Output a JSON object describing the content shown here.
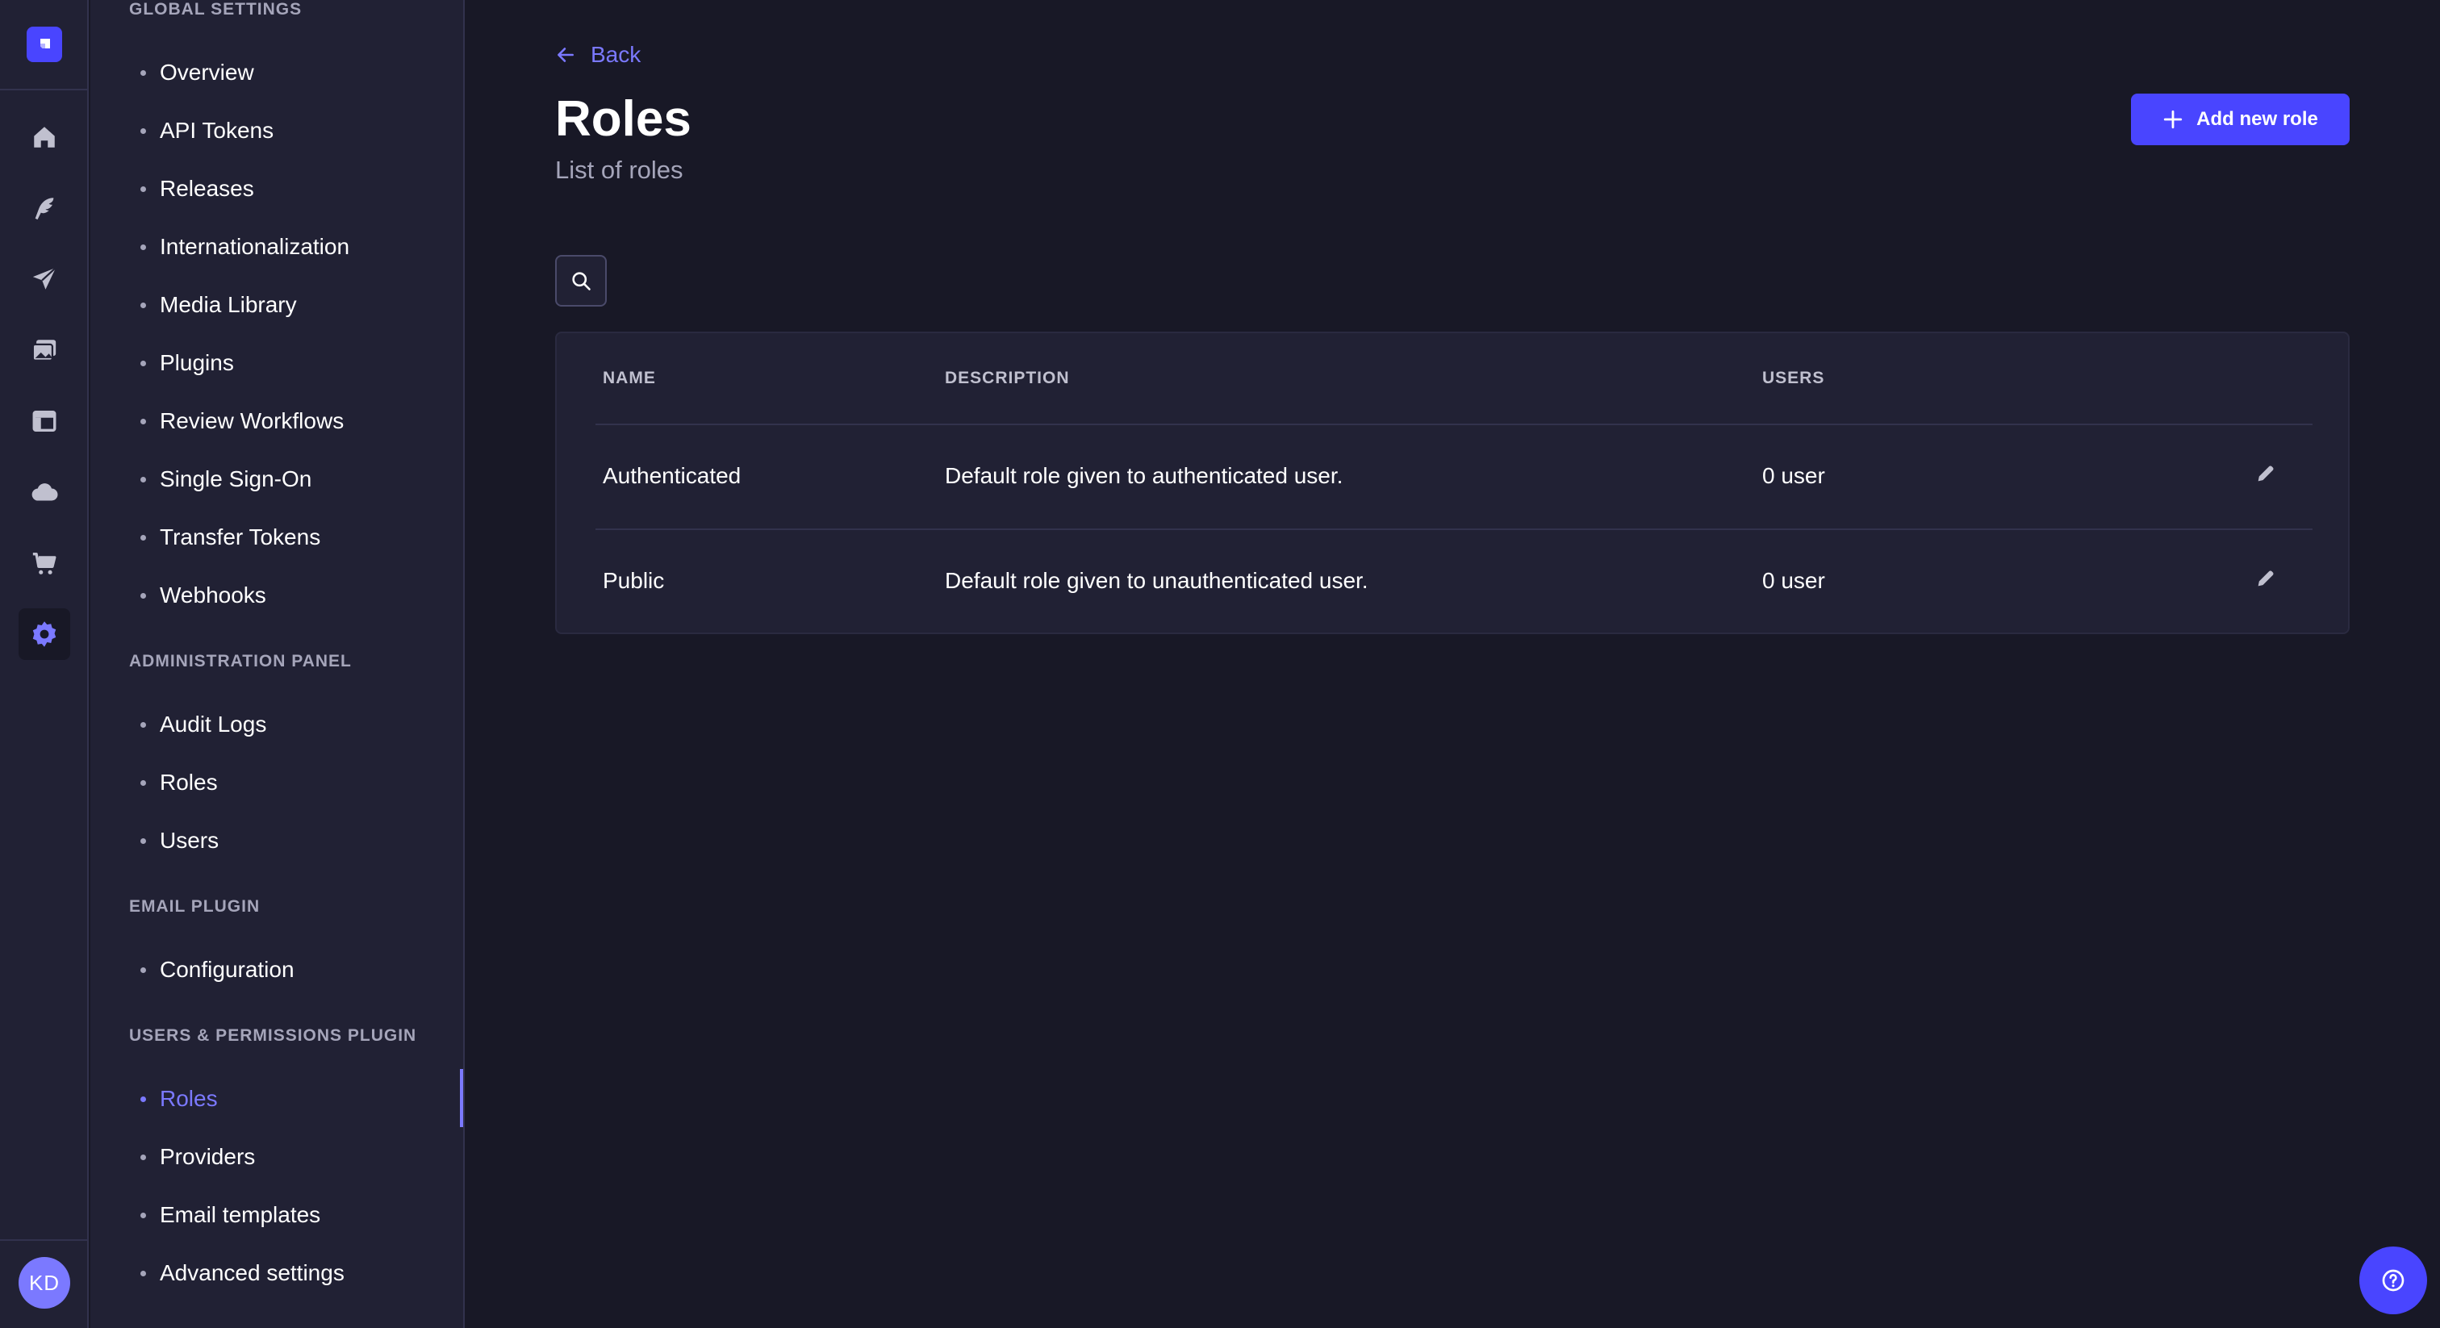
{
  "sidebar": {
    "sections": [
      {
        "title": "GLOBAL SETTINGS",
        "items": [
          "Overview",
          "API Tokens",
          "Releases",
          "Internationalization",
          "Media Library",
          "Plugins",
          "Review Workflows",
          "Single Sign-On",
          "Transfer Tokens",
          "Webhooks"
        ]
      },
      {
        "title": "ADMINISTRATION PANEL",
        "items": [
          "Audit Logs",
          "Roles",
          "Users"
        ]
      },
      {
        "title": "EMAIL PLUGIN",
        "items": [
          "Configuration"
        ]
      },
      {
        "title": "USERS & PERMISSIONS PLUGIN",
        "items": [
          "Roles",
          "Providers",
          "Email templates",
          "Advanced settings"
        ]
      }
    ],
    "active_item": "Roles"
  },
  "rail": {
    "icons": [
      "home-icon",
      "content-manager-icon",
      "deploy-icon",
      "media-library-icon",
      "content-type-builder-icon",
      "cloud-icon",
      "marketplace-icon",
      "settings-icon"
    ],
    "avatar_initials": "KD"
  },
  "main": {
    "back_label": "Back",
    "title": "Roles",
    "subtitle": "List of roles",
    "add_button_label": "Add new role",
    "table": {
      "columns": [
        "NAME",
        "DESCRIPTION",
        "USERS"
      ],
      "rows": [
        {
          "name": "Authenticated",
          "description": "Default role given to authenticated user.",
          "users": "0 user"
        },
        {
          "name": "Public",
          "description": "Default role given to unauthenticated user.",
          "users": "0 user"
        }
      ]
    }
  },
  "colors": {
    "background": "#181826",
    "panel": "#212134",
    "accent": "#4945ff",
    "accent_text": "#7b79ff",
    "muted_text": "#a5a5ba"
  }
}
